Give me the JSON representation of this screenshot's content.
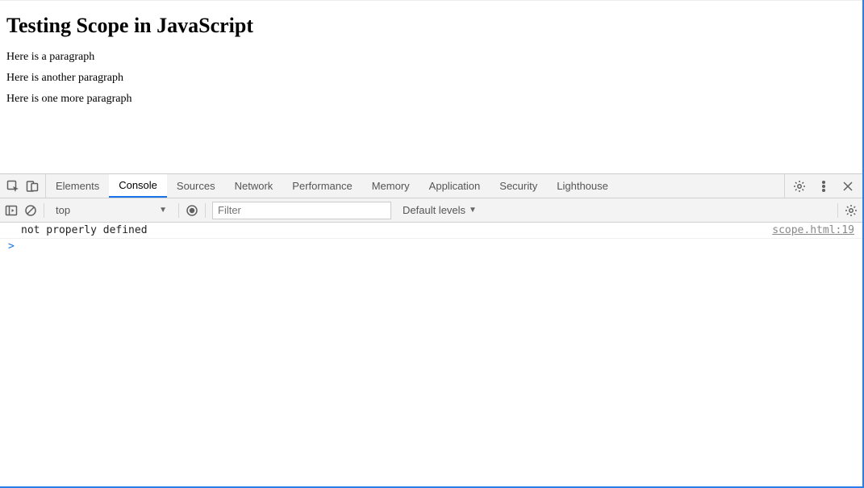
{
  "page": {
    "title": "Testing Scope in JavaScript",
    "paragraphs": [
      "Here is a paragraph",
      "Here is another paragraph",
      "Here is one more paragraph"
    ]
  },
  "devtools": {
    "tabs": {
      "elements": "Elements",
      "console": "Console",
      "sources": "Sources",
      "network": "Network",
      "performance": "Performance",
      "memory": "Memory",
      "application": "Application",
      "security": "Security",
      "lighthouse": "Lighthouse"
    },
    "toolbar": {
      "context": "top",
      "filter_placeholder": "Filter",
      "levels_label": "Default levels"
    },
    "console": {
      "messages": [
        {
          "text": "not properly defined",
          "source": "scope.html:19"
        }
      ],
      "prompt": ">"
    }
  }
}
